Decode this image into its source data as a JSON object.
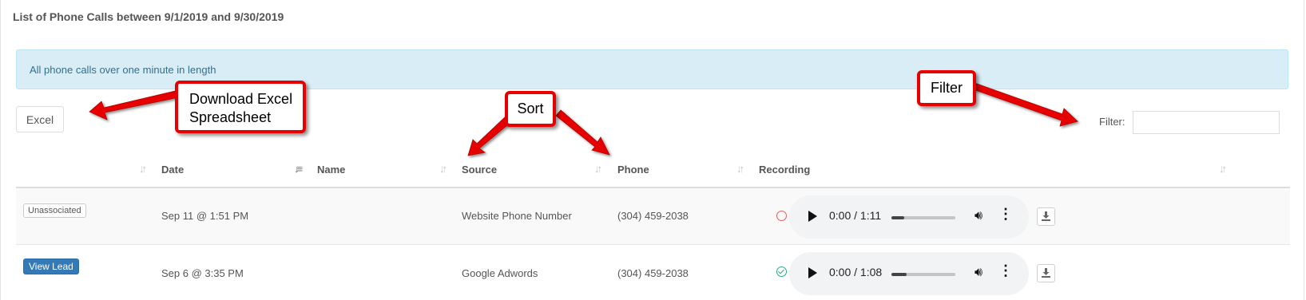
{
  "page": {
    "title": "List of Phone Calls between 9/1/2019 and 9/30/2019"
  },
  "info": {
    "text": "All phone calls over one minute in length"
  },
  "toolbar": {
    "excel_label": "Excel",
    "filter_label": "Filter:",
    "filter_value": ""
  },
  "table": {
    "columns": [
      {
        "label": ""
      },
      {
        "label": "Date"
      },
      {
        "label": "Name"
      },
      {
        "label": "Source"
      },
      {
        "label": "Phone"
      },
      {
        "label": "Recording"
      }
    ],
    "sorted_column": "Date",
    "rows": [
      {
        "status_badge": "Unassociated",
        "date": "Sep 11 @ 1:51 PM",
        "name": "",
        "source": "Website Phone Number",
        "phone": "(304) 459-2038",
        "recording_status": "not-listened",
        "player_time": "0:00 / 1:11",
        "progress": 0.2
      },
      {
        "action_label": "View Lead",
        "date": "Sep 6 @ 3:35 PM",
        "name": "",
        "source": "Google Adwords",
        "phone": "(304) 459-2038",
        "recording_status": "listened",
        "player_time": "0:00 / 1:08",
        "progress": 0.24
      }
    ]
  },
  "annotations": {
    "download": "Download Excel\nSpreadsheet",
    "download_line1": "Download Excel",
    "download_line2": "Spreadsheet",
    "sort": "Sort",
    "filter": "Filter"
  },
  "colors": {
    "info_bg": "#d9edf7",
    "info_text": "#31708f",
    "primary_button": "#337ab7",
    "annotation_red": "#e60000",
    "status_unheard": "#e06060",
    "status_heard": "#2eaa7a"
  },
  "icons": [
    "sort-icon",
    "sort-desc-icon",
    "play-icon",
    "volume-icon",
    "more-options-icon",
    "download-icon",
    "check-circle-icon",
    "empty-circle-icon"
  ]
}
